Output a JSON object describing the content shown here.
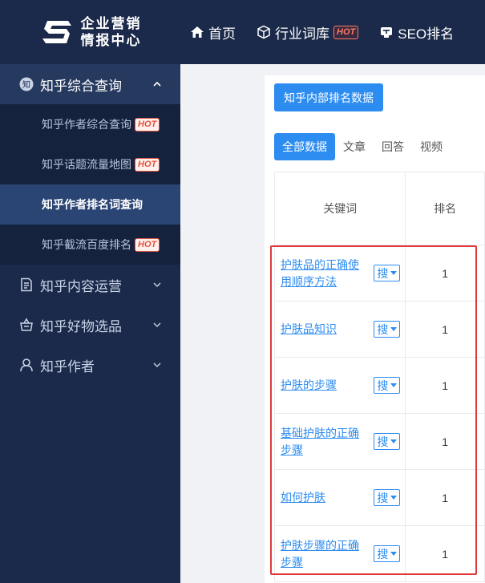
{
  "brand": {
    "line1": "企业营销",
    "line2": "情报中心"
  },
  "nav": [
    {
      "label": "首页",
      "icon": "home-icon"
    },
    {
      "label": "行业词库",
      "icon": "cube-icon",
      "badge": "HOT"
    },
    {
      "label": "SEO排名",
      "icon": "ranking-icon"
    }
  ],
  "sidebar": {
    "open_menu": {
      "label": "知乎综合查询",
      "icon": "zhihu-icon"
    },
    "sub_items": [
      {
        "label": "知乎作者综合查询",
        "badge": "HOT",
        "active": false
      },
      {
        "label": "知乎话题流量地图",
        "badge": "HOT",
        "active": false
      },
      {
        "label": "知乎作者排名词查询",
        "badge": "",
        "active": true
      },
      {
        "label": "知乎截流百度排名",
        "badge": "HOT",
        "active": false
      }
    ],
    "menus": [
      {
        "label": "知乎内容运营",
        "icon": "document-icon"
      },
      {
        "label": "知乎好物选品",
        "icon": "basket-icon"
      },
      {
        "label": "知乎作者",
        "icon": "user-icon"
      }
    ]
  },
  "main": {
    "primary_button": "知乎内部排名数据",
    "tabs": [
      "全部数据",
      "文章",
      "回答",
      "视频"
    ],
    "active_tab": 0,
    "table": {
      "headers": [
        "关键词",
        "排名"
      ],
      "search_label": "搜",
      "rows": [
        {
          "keyword": "护肤品的正确使用顺序方法",
          "rank": "1"
        },
        {
          "keyword": "护肤品知识",
          "rank": "1"
        },
        {
          "keyword": "护肤的步骤",
          "rank": "1"
        },
        {
          "keyword": "基础护肤的正确步骤",
          "rank": "1"
        },
        {
          "keyword": "如何护肤",
          "rank": "1"
        },
        {
          "keyword": "护肤步骤的正确步骤",
          "rank": "1"
        }
      ]
    }
  },
  "colors": {
    "sidebar_bg": "#1b2a4a",
    "primary": "#2d8cf0",
    "highlight": "#e0393c",
    "hot": "#e4533d"
  }
}
